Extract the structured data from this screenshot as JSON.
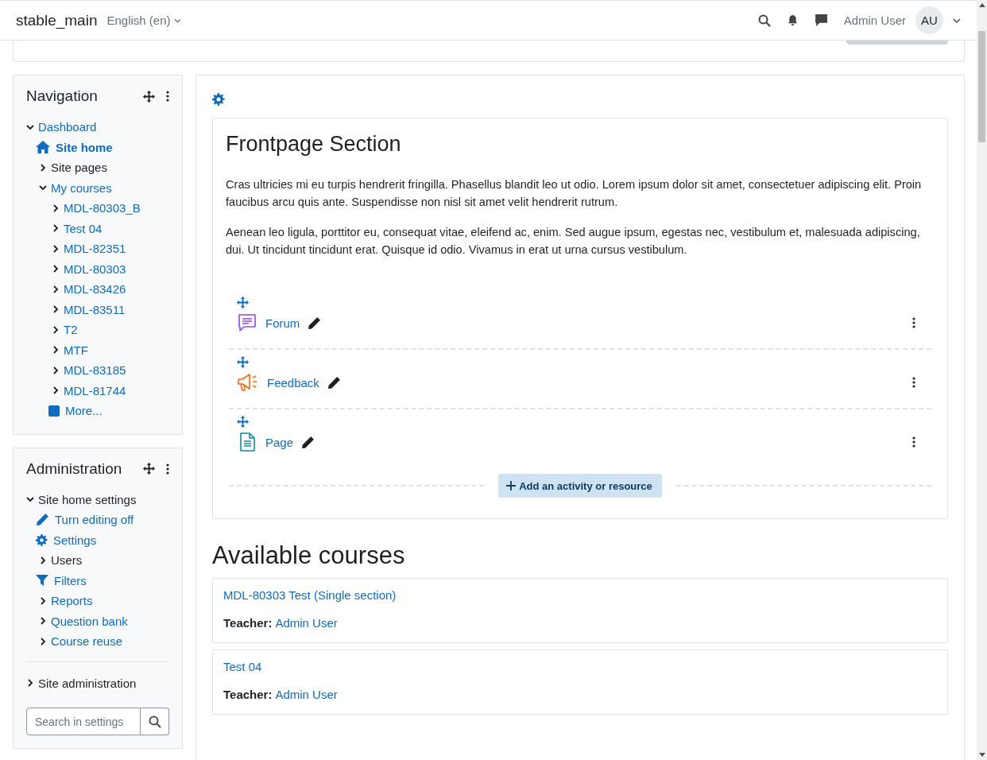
{
  "navbar": {
    "site_name": "stable_main",
    "language": "English (en)",
    "user_name": "Admin User",
    "avatar_initials": "AU"
  },
  "navigation": {
    "title": "Navigation",
    "items": [
      {
        "label": "Dashboard",
        "kind": "branch",
        "expanded": true,
        "children": [
          {
            "label": "Site home",
            "kind": "home"
          },
          {
            "label": "Site pages",
            "kind": "category",
            "expanded": false
          },
          {
            "label": "My courses",
            "kind": "branch",
            "expanded": true,
            "children": [
              {
                "label": "MDL-80303_B",
                "kind": "branch",
                "expanded": false
              },
              {
                "label": "Test 04",
                "kind": "branch",
                "expanded": false
              },
              {
                "label": "MDL-82351",
                "kind": "branch",
                "expanded": false
              },
              {
                "label": "MDL-80303",
                "kind": "branch",
                "expanded": false
              },
              {
                "label": "MDL-83426",
                "kind": "branch",
                "expanded": false
              },
              {
                "label": "MDL-83511",
                "kind": "branch",
                "expanded": false
              },
              {
                "label": "T2",
                "kind": "branch",
                "expanded": false
              },
              {
                "label": "MTF",
                "kind": "branch",
                "expanded": false
              },
              {
                "label": "MDL-83185",
                "kind": "branch",
                "expanded": false
              },
              {
                "label": "MDL-81744",
                "kind": "branch",
                "expanded": false
              },
              {
                "label": "More...",
                "kind": "more"
              }
            ]
          }
        ]
      }
    ]
  },
  "administration": {
    "title": "Administration",
    "items": [
      {
        "label": "Site home settings",
        "kind": "category",
        "expanded": true,
        "children": [
          {
            "label": "Turn editing off",
            "kind": "edit"
          },
          {
            "label": "Settings",
            "kind": "gear"
          },
          {
            "label": "Users",
            "kind": "category",
            "expanded": false
          },
          {
            "label": "Filters",
            "kind": "filter"
          },
          {
            "label": "Reports",
            "kind": "branch",
            "expanded": false
          },
          {
            "label": "Question bank",
            "kind": "branch",
            "expanded": false
          },
          {
            "label": "Course reuse",
            "kind": "branch",
            "expanded": false
          }
        ]
      }
    ],
    "footer_items": [
      {
        "label": "Site administration",
        "kind": "category",
        "expanded": false
      }
    ],
    "search": {
      "placeholder": "Search in settings"
    }
  },
  "frontpage": {
    "title": "Frontpage Section",
    "paragraphs": [
      "Cras ultricies mi eu turpis hendrerit fringilla. Phasellus blandit leo ut odio. Lorem ipsum dolor sit amet, consectetuer adipiscing elit. Proin faucibus arcu quis ante. Suspendisse non nisl sit amet velit hendrerit rutrum.",
      "Aenean leo ligula, porttitor eu, consequat vitae, eleifend ac, enim. Sed augue ipsum, egestas nec, vestibulum et, malesuada adipiscing, dui. Ut tincidunt tincidunt erat. Quisque id odio. Vivamus in erat ut urna cursus vestibulum."
    ],
    "activities": [
      {
        "name": "Forum",
        "kind": "forum"
      },
      {
        "name": "Feedback",
        "kind": "feedback"
      },
      {
        "name": "Page",
        "kind": "page"
      }
    ],
    "add_button": "Add an activity or resource"
  },
  "available_courses": {
    "heading": "Available courses",
    "courses": [
      {
        "name": "MDL-80303 Test (Single section)",
        "teacher_label": "Teacher:",
        "teacher": "Admin User"
      },
      {
        "name": "Test 04",
        "teacher_label": "Teacher:",
        "teacher": "Admin User"
      }
    ]
  }
}
